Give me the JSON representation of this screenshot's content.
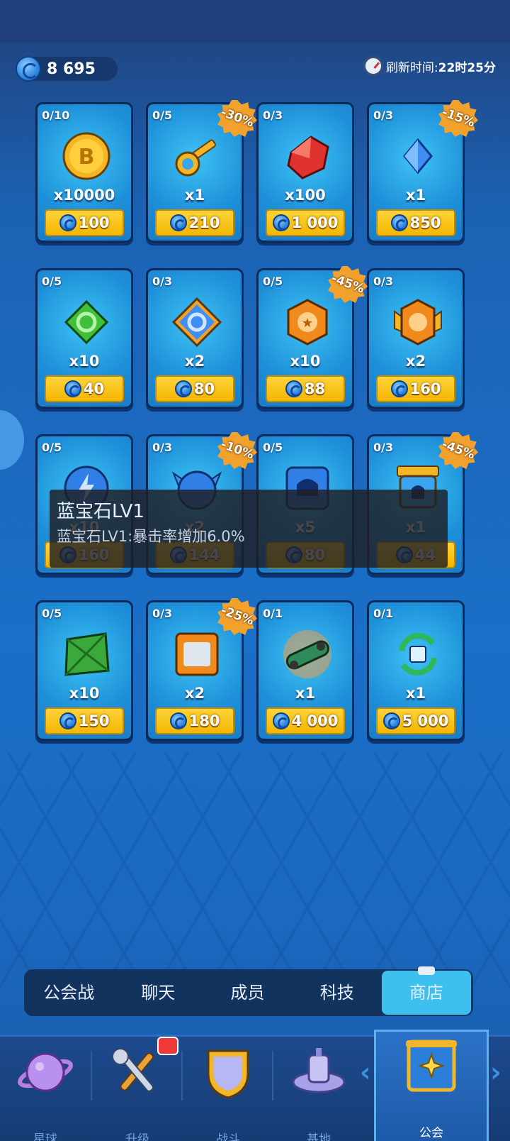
{
  "header": {
    "currency_amount": "8 695",
    "refresh_label": "刷新时间:",
    "refresh_time": "22时25分"
  },
  "items": [
    {
      "stock": "0/10",
      "qty": "x10000",
      "price": "100",
      "discount": "",
      "icon": "gold-coin-icon"
    },
    {
      "stock": "0/5",
      "qty": "x1",
      "price": "210",
      "discount": "-30%",
      "icon": "golden-key-icon"
    },
    {
      "stock": "0/3",
      "qty": "x100",
      "price": "1 000",
      "discount": "",
      "icon": "red-gem-icon"
    },
    {
      "stock": "0/3",
      "qty": "x1",
      "price": "850",
      "discount": "-15%",
      "icon": "blue-sapphire-icon"
    },
    {
      "stock": "0/5",
      "qty": "x10",
      "price": "40",
      "discount": "",
      "icon": "green-chip-icon"
    },
    {
      "stock": "0/3",
      "qty": "x2",
      "price": "80",
      "discount": "",
      "icon": "blue-chip-icon"
    },
    {
      "stock": "0/5",
      "qty": "x10",
      "price": "88",
      "discount": "-45%",
      "icon": "orange-star-chip-icon"
    },
    {
      "stock": "0/3",
      "qty": "x2",
      "price": "160",
      "discount": "",
      "icon": "orange-winged-chip-icon"
    },
    {
      "stock": "0/5",
      "qty": "x10",
      "price": "160",
      "discount": "",
      "icon": "blue-energy-orb-icon"
    },
    {
      "stock": "0/3",
      "qty": "x2",
      "price": "144",
      "discount": "-10%",
      "icon": "blue-winged-orb-icon"
    },
    {
      "stock": "0/5",
      "qty": "x5",
      "price": "80",
      "discount": "",
      "icon": "blue-helmet-box-icon"
    },
    {
      "stock": "0/3",
      "qty": "x1",
      "price": "44",
      "discount": "-45%",
      "icon": "golden-capsule-icon"
    },
    {
      "stock": "0/5",
      "qty": "x10",
      "price": "150",
      "discount": "",
      "icon": "green-crate-icon"
    },
    {
      "stock": "0/3",
      "qty": "x2",
      "price": "180",
      "discount": "-25%",
      "icon": "armor-crate-icon"
    },
    {
      "stock": "0/1",
      "qty": "x1",
      "price": "4 000",
      "discount": "",
      "icon": "skateboard-icon"
    },
    {
      "stock": "0/1",
      "qty": "x1",
      "price": "5 000",
      "discount": "",
      "icon": "recycle-chip-icon"
    }
  ],
  "tooltip": {
    "title": "蓝宝石LV1",
    "desc": "蓝宝石LV1:暴击率增加6.0%"
  },
  "subtabs": [
    "公会战",
    "聊天",
    "成员",
    "科技",
    "商店"
  ],
  "subtab_active": "商店",
  "nav": [
    "星球",
    "升级",
    "战斗",
    "基地",
    "公会"
  ],
  "nav_active": "公会",
  "colors": {
    "accent": "#3ec0ef",
    "price_button": "#ffd33a",
    "badge": "#f2a22c"
  }
}
